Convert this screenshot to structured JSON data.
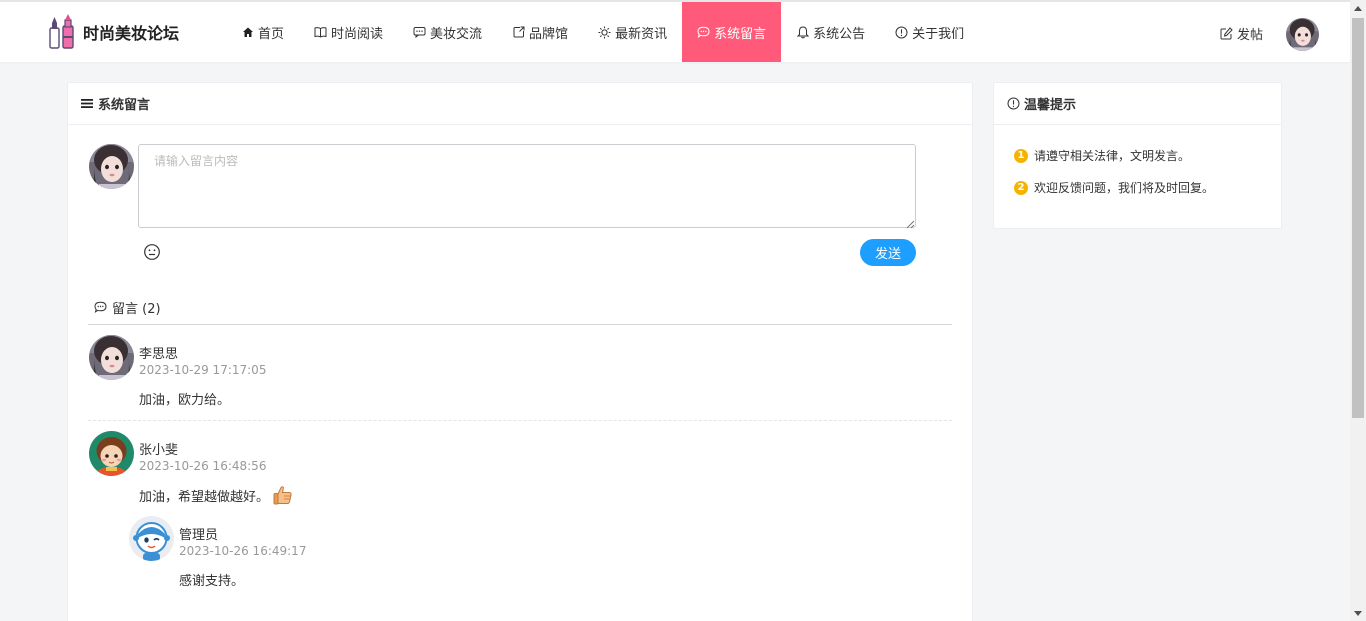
{
  "header": {
    "logo_text": "时尚美妆论坛",
    "nav": [
      {
        "label": "首页",
        "icon": "home-icon"
      },
      {
        "label": "时尚阅读",
        "icon": "book-icon"
      },
      {
        "label": "美妆交流",
        "icon": "chat-icon"
      },
      {
        "label": "品牌馆",
        "icon": "share-icon"
      },
      {
        "label": "最新资讯",
        "icon": "sun-icon"
      },
      {
        "label": "系统留言",
        "icon": "message-icon",
        "active": true
      },
      {
        "label": "系统公告",
        "icon": "bell-icon"
      },
      {
        "label": "关于我们",
        "icon": "info-icon"
      }
    ],
    "post_label": "发帖"
  },
  "main": {
    "title": "系统留言",
    "compose": {
      "placeholder": "请输入留言内容",
      "value": "",
      "send_label": "发送"
    },
    "count_label": "留言 (2)",
    "comments": [
      {
        "user": "李思思",
        "time": "2023-10-29 17:17:05",
        "content": "加油，欧力给。"
      },
      {
        "user": "张小斐",
        "time": "2023-10-26 16:48:56",
        "content": "加油，希望越做越好。"
      }
    ],
    "reply": {
      "user": "管理员",
      "time": "2023-10-26 16:49:17",
      "content": "感谢支持。"
    }
  },
  "side": {
    "title": "温馨提示",
    "tips": [
      {
        "num": "1",
        "text": "请遵守相关法律，文明发言。"
      },
      {
        "num": "2",
        "text": "欢迎反馈问题，我们将及时回复。"
      }
    ]
  },
  "colors": {
    "accent_active": "#ff5a7a",
    "send_button": "#1e9fff",
    "tip_badge": "#f5b300"
  }
}
